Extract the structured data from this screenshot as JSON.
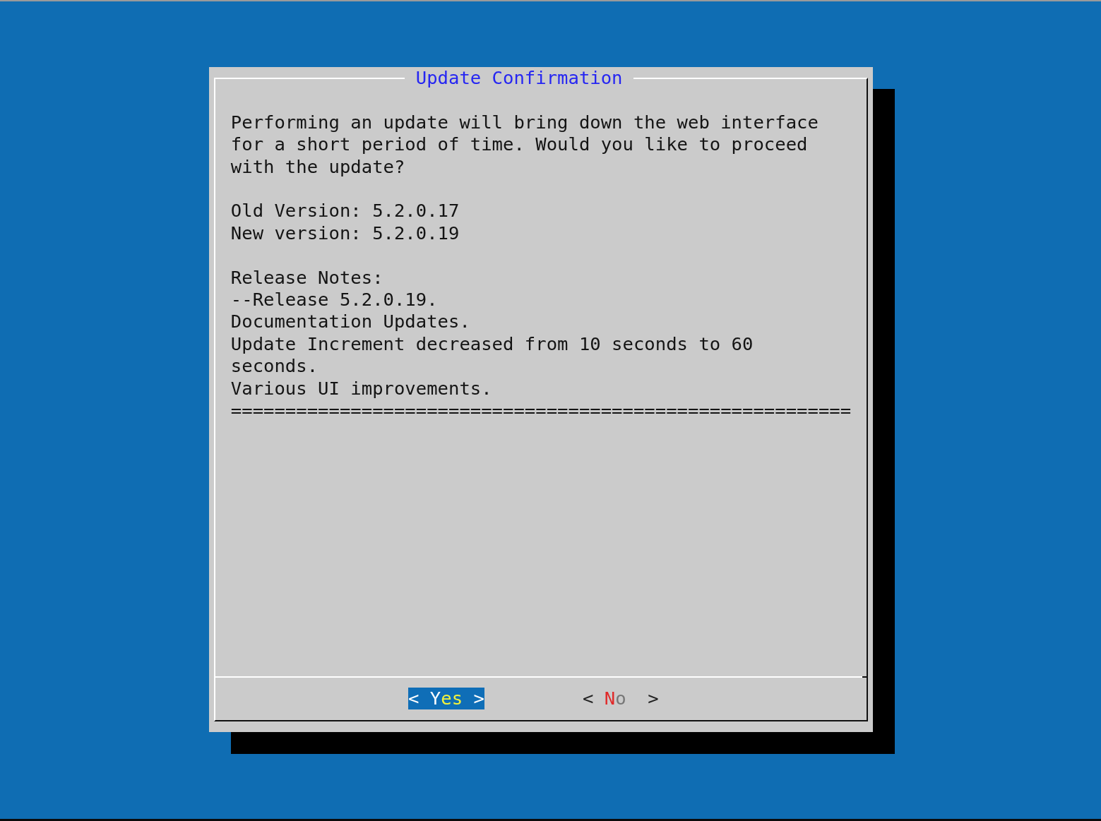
{
  "dialog": {
    "title": "Update Confirmation",
    "message": "Performing an update will bring down the web interface for a short period of time. Would you like to proceed with the update?",
    "versions": [
      "Old Version: 5.2.0.17",
      "New version: 5.2.0.19"
    ],
    "release_notes_heading": "Release Notes:",
    "release_notes": [
      "--Release 5.2.0.19.",
      "Documentation Updates.",
      "Update Increment decreased from 10 seconds to 60 seconds.",
      "Various UI improvements."
    ],
    "divider": "=========================================================",
    "buttons": [
      {
        "left": "<",
        "label": "Yes",
        "right": ">",
        "selected": true
      },
      {
        "left": "<",
        "label": "No",
        "right": ">",
        "selected": false
      }
    ]
  }
}
